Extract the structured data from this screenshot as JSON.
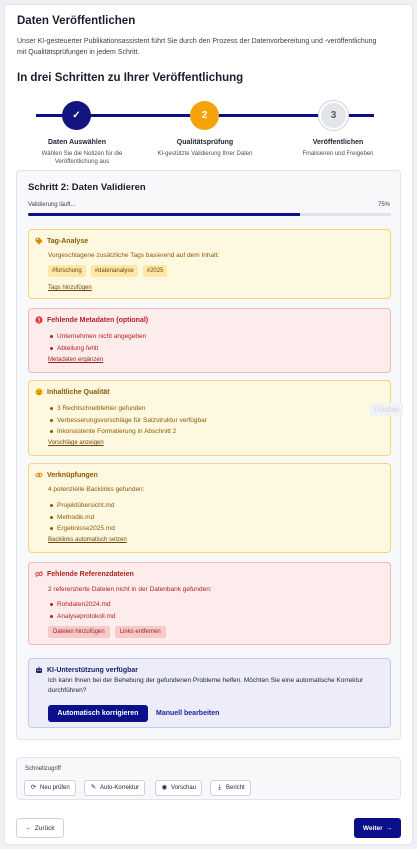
{
  "page": {
    "title": "Daten Veröffentlichen",
    "intro": "Unser KI-gesteuerter Publikationsassistent führt Sie durch den Prozess der Datenvorbereitung und -veröffentlichung mit Qualitätsprüfungen in jedem Schritt.",
    "steps_title": "In drei Schritten zu Ihrer Veröffentlichung"
  },
  "steps": [
    {
      "marker": "✓",
      "label": "Daten Auswählen",
      "desc": "Wählen Sie die Notizen für die Veröffentlichung aus",
      "state": "done"
    },
    {
      "marker": "2",
      "label": "Qualitätsprüfung",
      "desc": "KI-gestützte Validierung Ihrer Daten",
      "state": "active"
    },
    {
      "marker": "3",
      "label": "Veröffentlichen",
      "desc": "Finalisieren und Freigeben",
      "state": "pending"
    }
  ],
  "validation": {
    "title": "Schritt 2: Daten Validieren",
    "progress_label": "Validierung läuft...",
    "progress_text": "75%",
    "progress_value": 0.75
  },
  "tag_analysis": {
    "icon": "tag-icon",
    "title": "Tag-Analyse",
    "text": "Vorgeschlagene zusätzliche Tags basierend auf dem Inhalt:",
    "tags": [
      "#forschung",
      "#datenanalyse",
      "#2025"
    ],
    "link": "Tags hinzufügen"
  },
  "metadata": {
    "icon": "alert-icon",
    "title": "Fehlende Metadaten (optional)",
    "items": [
      "Unternehmen nicht angegeben",
      "Abteilung fehlt"
    ],
    "link": "Metadaten ergänzen"
  },
  "quality": {
    "icon": "face-icon",
    "title": "Inhaltliche Qualität",
    "items": [
      "3 Rechtschreibfehler gefunden",
      "Verbesserungsvorschläge für Satzstruktur verfügbar",
      "Inkonsistente Formatierung in Abschnitt 2"
    ],
    "link": "Vorschläge anzeigen"
  },
  "links": {
    "icon": "link-icon",
    "title": "Verknüpfungen",
    "text": "4 potenzielle Backlinks gefunden:",
    "items": [
      "Projektübersicht.md",
      "Methodik.md",
      "Ergebnisse2025.md"
    ],
    "link": "Backlinks automatisch setzen"
  },
  "references": {
    "icon": "broken-link-icon",
    "title": "Fehlende Referenzdateien",
    "text": "2 referenzierte Dateien nicht in der Datenbank gefunden:",
    "items": [
      "Rohdaten2024.md",
      "Analyseprotokoll.md"
    ],
    "buttons": [
      "Dateien hinzufügen",
      "Links entfernen"
    ]
  },
  "ai": {
    "icon": "robot-icon",
    "title": "KI-Unterstützung verfügbar",
    "text": "Ich kann Ihnen bei der Behebung der gefundenen Probleme helfen. Möchten Sie eine automatische Korrektur durchführen?",
    "primary": "Automatisch korrigieren",
    "secondary": "Manuell bearbeiten"
  },
  "quick": {
    "title": "Schnellzugriff",
    "buttons": [
      {
        "icon": "refresh-icon",
        "glyph": "⟳",
        "label": "Neu prüfen"
      },
      {
        "icon": "pencil-icon",
        "glyph": "✎",
        "label": "Auto-Korrektur"
      },
      {
        "icon": "eye-icon",
        "glyph": "◉",
        "label": "Vorschau"
      },
      {
        "icon": "download-icon",
        "glyph": "⤓",
        "label": "Bericht"
      }
    ]
  },
  "nav": {
    "back": "Zurück",
    "next": "Weiter"
  },
  "overlay": {
    "text": "Double"
  },
  "colors": {
    "primary": "#0b0f8a",
    "accent": "#f5a20b",
    "warning_bg": "#fff8e1",
    "error_bg": "#fdecec"
  }
}
